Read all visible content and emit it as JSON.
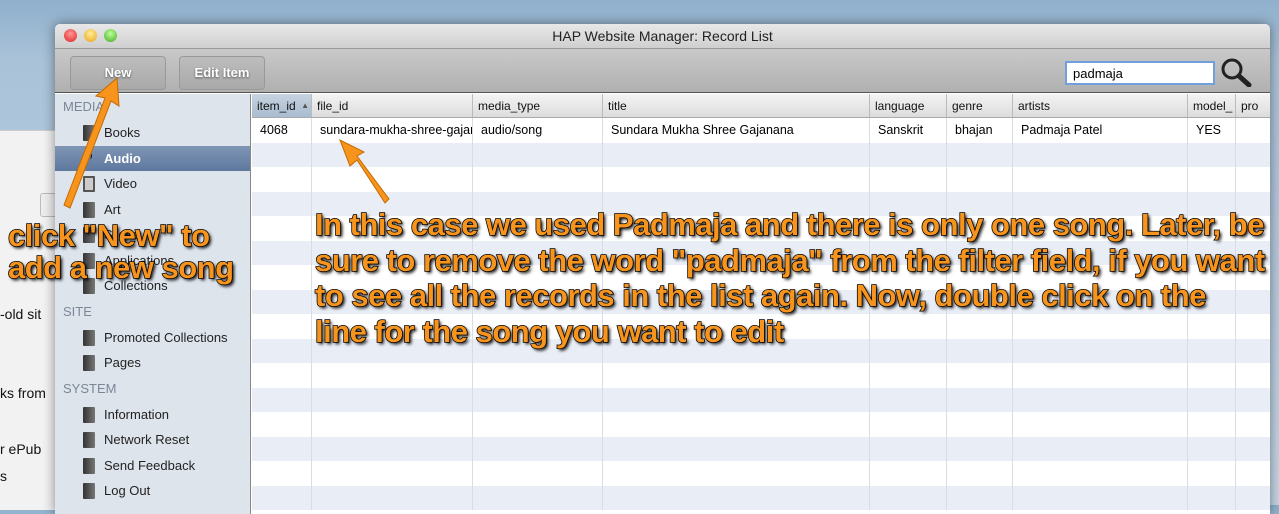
{
  "background_window": {
    "fragments": [
      "-old sit",
      "ks from",
      "r ePub",
      "s"
    ]
  },
  "window": {
    "title": "HAP Website Manager: Record List"
  },
  "toolbar": {
    "new_label": "New",
    "edit_label": "Edit Item",
    "search_value": "padmaja",
    "search_icon": "magnifier-icon"
  },
  "sidebar": {
    "sections": [
      {
        "label": "MEDIA",
        "items": [
          {
            "label": "Books",
            "icon": "book-icon"
          },
          {
            "label": "Audio",
            "icon": "music-note-icon",
            "selected": true
          },
          {
            "label": "Video",
            "icon": "film-icon"
          },
          {
            "label": "Art",
            "icon": "palette-icon"
          },
          {
            "label": "Slides",
            "icon": "slides-icon"
          },
          {
            "label": "Applications",
            "icon": "app-icon"
          },
          {
            "label": "Collections",
            "icon": "collection-icon"
          }
        ]
      },
      {
        "label": "SITE",
        "items": [
          {
            "label": "Promoted Collections",
            "icon": "book-icon"
          },
          {
            "label": "Pages",
            "icon": "book-icon"
          }
        ]
      },
      {
        "label": "SYSTEM",
        "items": [
          {
            "label": "Information",
            "icon": "book-icon"
          },
          {
            "label": "Network Reset",
            "icon": "book-icon"
          },
          {
            "label": "Send Feedback",
            "icon": "book-icon"
          },
          {
            "label": "Log Out",
            "icon": "book-icon"
          }
        ]
      }
    ]
  },
  "table": {
    "columns": [
      "item_id",
      "file_id",
      "media_type",
      "title",
      "language",
      "genre",
      "artists",
      "model_",
      "pro"
    ],
    "sorted_column": "item_id",
    "rows": [
      [
        "4068",
        "sundara-mukha-shree-gajanana",
        "audio/song",
        "Sundara Mukha Shree Gajanana",
        "Sanskrit",
        "bhajan",
        "Padmaja Patel",
        "YES",
        ""
      ]
    ]
  },
  "annotations": {
    "new_hint": "click \"New\" to add a new song",
    "filter_hint": "In this case we used Padmaja and there is only one song. Later, be sure to remove the word \"padmaja\" from the filter field, if you want to see all the records in the list again. Now, double click on the line for the song you want to edit",
    "color": "#f7941d"
  }
}
